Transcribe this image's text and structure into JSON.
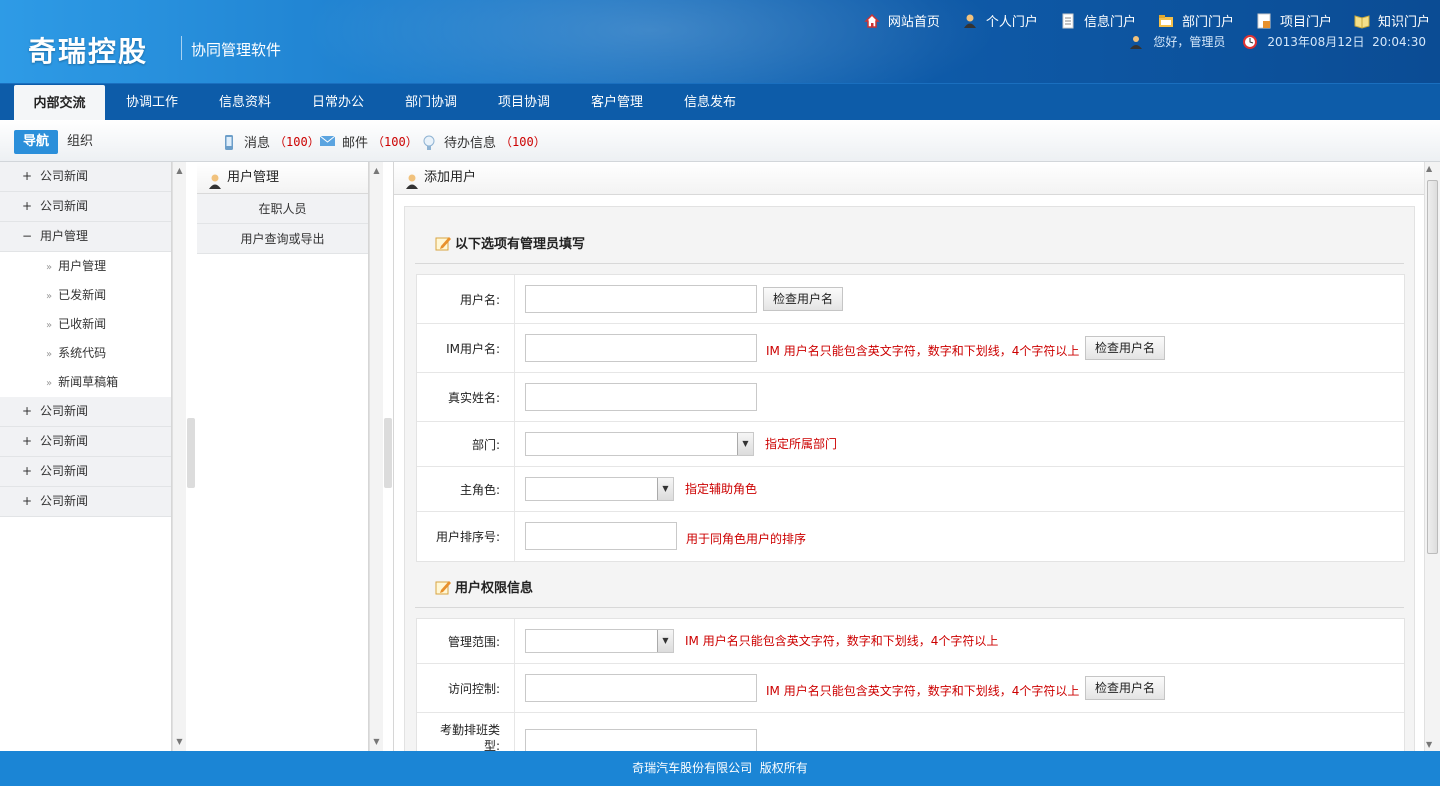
{
  "header": {
    "logo": "奇瑞控股",
    "subtitle": "协同管理软件",
    "links": [
      {
        "label": "网站首页",
        "icon": "home-icon"
      },
      {
        "label": "个人门户",
        "icon": "person-icon"
      },
      {
        "label": "信息门户",
        "icon": "document-icon"
      },
      {
        "label": "部门门户",
        "icon": "folder-icon"
      },
      {
        "label": "项目门户",
        "icon": "project-icon"
      },
      {
        "label": "知识门户",
        "icon": "book-icon"
      }
    ],
    "greeting": "您好，管理员",
    "datetime": "2013年08月12日  20:04:30"
  },
  "nav": {
    "tabs": [
      "内部交流",
      "协调工作",
      "信息资料",
      "日常办公",
      "部门协调",
      "项目协调",
      "客户管理",
      "信息发布"
    ],
    "active_index": 0
  },
  "subbar": {
    "nav_btn": "导航",
    "org_btn": "组织",
    "messages": {
      "label": "消息",
      "count": "（100）"
    },
    "mail": {
      "label": "邮件",
      "count": "（100）"
    },
    "todo": {
      "label": "待办信息",
      "count": "（100）"
    }
  },
  "left_menu": {
    "items": [
      {
        "label": "公司新闻",
        "sign": "+"
      },
      {
        "label": "公司新闻",
        "sign": "+"
      },
      {
        "label": "用户管理",
        "sign": "−"
      },
      {
        "label": "公司新闻",
        "sign": "+"
      },
      {
        "label": "公司新闻",
        "sign": "+"
      },
      {
        "label": "公司新闻",
        "sign": "+"
      },
      {
        "label": "公司新闻",
        "sign": "+"
      }
    ],
    "sub_items": [
      "用户管理",
      "已发新闻",
      "已收新闻",
      "系统代码",
      "新闻草稿箱"
    ],
    "arrow": "»"
  },
  "mid_panel": {
    "title": "用户管理",
    "rows": [
      "在职人员",
      "用户查询或导出"
    ]
  },
  "main": {
    "title": "添加用户",
    "section1": "以下选项有管理员填写",
    "section2": "用户权限信息",
    "fields": {
      "username": {
        "label": "用户名:",
        "button": "检查用户名"
      },
      "im_username": {
        "label": "IM用户名:",
        "hint": "IM 用户名只能包含英文字符，数字和下划线，4个字符以上",
        "button": "检查用户名"
      },
      "realname": {
        "label": "真实姓名:"
      },
      "dept": {
        "label": "部门:",
        "hint": "指定所属部门"
      },
      "role": {
        "label": "主角色:",
        "hint": "指定辅助角色"
      },
      "order": {
        "label": "用户排序号:",
        "hint": "用于同角色用户的排序"
      },
      "scope": {
        "label": "管理范围:",
        "hint": "IM 用户名只能包含英文字符，数字和下划线，4个字符以上"
      },
      "access": {
        "label": "访问控制:",
        "hint": "IM 用户名只能包含英文字符，数字和下划线，4个字符以上",
        "button": "检查用户名"
      },
      "shift": {
        "label": "考勤排班类型:"
      }
    }
  },
  "footer": {
    "text": "奇瑞汽车股份有限公司  版权所有"
  },
  "colors": {
    "header": "#1a78c8",
    "nav": "#0d5ca9",
    "accent": "#2b8fda",
    "hint": "#cc0000",
    "footer": "#1b85d5"
  }
}
